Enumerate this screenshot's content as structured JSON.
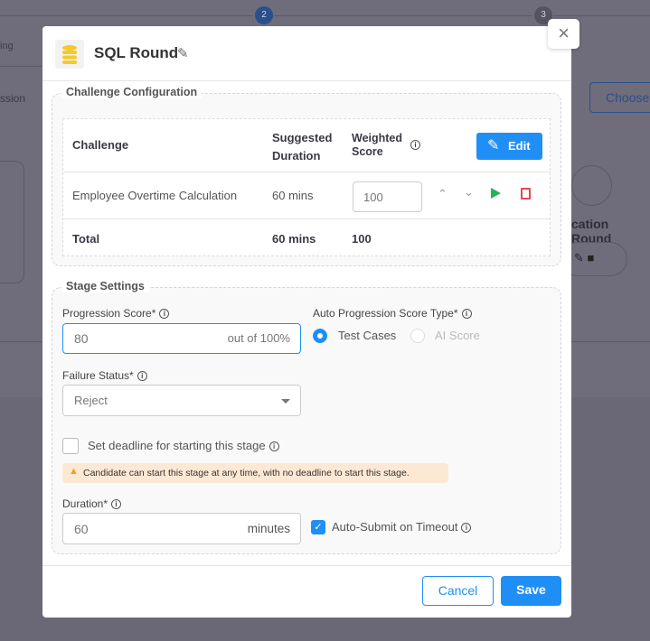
{
  "background": {
    "step2": "2",
    "step3": "3",
    "left_text_1": "ing",
    "left_text_2": "ssion",
    "choose_button": "Choose",
    "round_label": "cation Round"
  },
  "modal": {
    "title": "SQL Round",
    "close": "×",
    "challenge_config": {
      "legend": "Challenge Configuration",
      "headers": {
        "challenge": "Challenge",
        "duration": "Suggested Duration",
        "score": "Weighted Score"
      },
      "edit_label": "Edit",
      "rows": [
        {
          "challenge": "Employee Overtime Calculation",
          "duration": "60 mins",
          "score": "100"
        }
      ],
      "total": {
        "label": "Total",
        "duration": "60 mins",
        "score": "100"
      }
    },
    "stage_settings": {
      "legend": "Stage Settings",
      "progression_label": "Progression Score*",
      "progression_value": "80",
      "progression_suffix": "out of 100%",
      "auto_type_label": "Auto Progression Score Type*",
      "options": [
        {
          "label": "Test Cases",
          "selected": true
        },
        {
          "label": "AI Score",
          "selected": false,
          "disabled": true
        }
      ],
      "failure_label": "Failure Status*",
      "failure_value": "Reject",
      "deadline_label": "Set deadline for starting this stage",
      "deadline_checked": false,
      "warning": "Candidate can start this stage at any time, with no deadline to start this stage.",
      "duration_label": "Duration*",
      "duration_value": "60",
      "duration_suffix": "minutes",
      "auto_submit_label": "Auto-Submit on Timeout",
      "auto_submit_checked": true
    },
    "footer": {
      "cancel": "Cancel",
      "save": "Save"
    }
  },
  "colors": {
    "primary": "#1f8ff5",
    "warning_bg": "#fde8d4",
    "play": "#22b35a",
    "delete": "#e5484d"
  }
}
